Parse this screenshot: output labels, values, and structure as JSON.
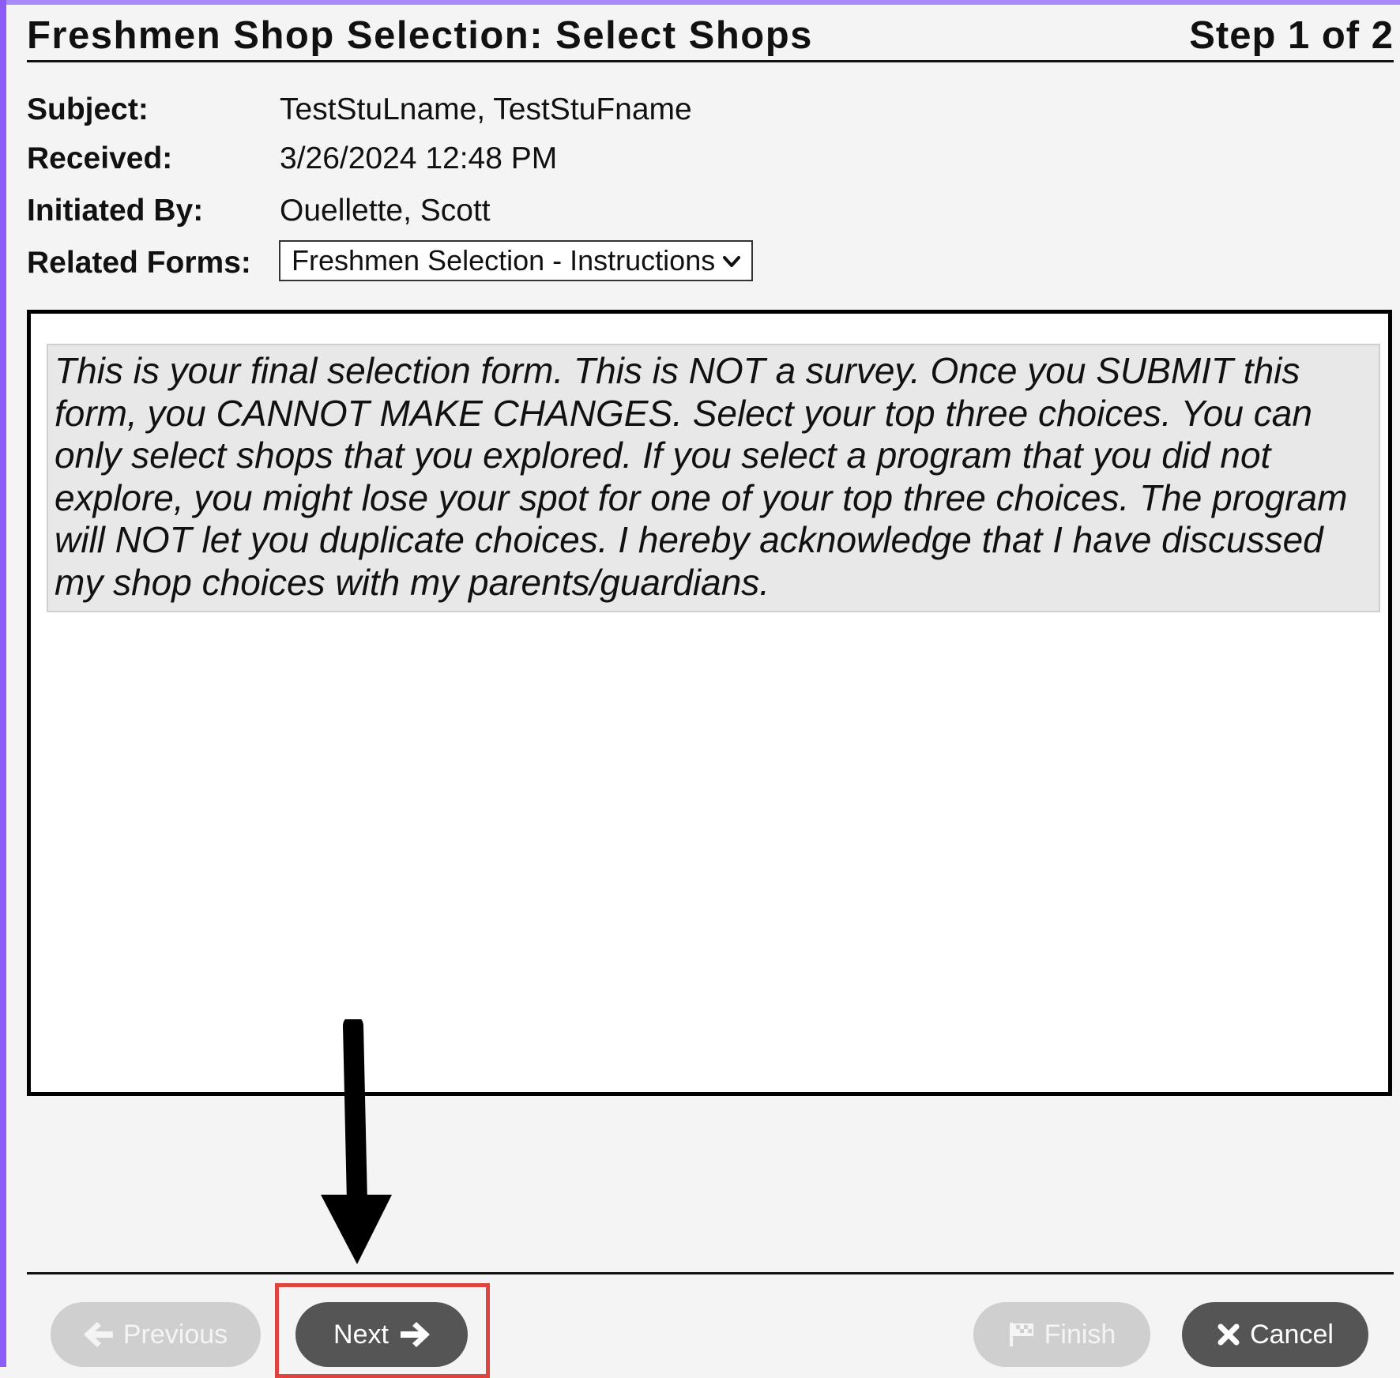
{
  "header": {
    "title": "Freshmen Shop Selection: Select Shops",
    "step": "Step 1 of 2"
  },
  "meta": {
    "subject_label": "Subject:",
    "subject_value": "TestStuLname, TestStuFname",
    "received_label": "Received:",
    "received_value": "3/26/2024 12:48 PM",
    "initiated_label": "Initiated By:",
    "initiated_value": "Ouellette, Scott",
    "related_label": "Related Forms:",
    "related_selected": "Freshmen Selection - Instructions"
  },
  "instructions": {
    "text": "This is your final selection form. This is NOT a survey. Once you SUBMIT this form, you CANNOT MAKE CHANGES. Select your top three choices. You can only select shops that you explored. If you select a program that you did not explore, you might lose your spot for one of your top three choices. The program will NOT let you duplicate choices. I hereby acknowledge that I have discussed my shop choices with my parents/guardians."
  },
  "buttons": {
    "previous": "Previous",
    "next": "Next",
    "finish": "Finish",
    "cancel": "Cancel"
  },
  "icons": {
    "previous": "arrow-left-icon",
    "next": "arrow-right-icon",
    "finish": "flag-icon",
    "cancel": "x-icon",
    "select": "chevron-down-icon"
  },
  "colors": {
    "accent": "#8b5cf6",
    "button_active": "#555555",
    "button_disabled": "#cfcfcf",
    "highlight": "#e0443e"
  }
}
